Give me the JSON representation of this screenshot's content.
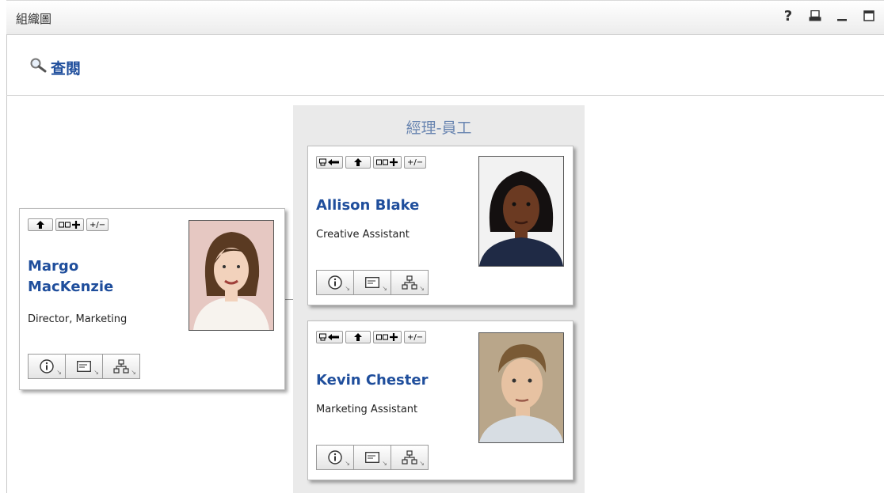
{
  "portlet": {
    "title": "組織圖",
    "controls": {
      "help": "?",
      "print": "print-icon",
      "minimize": "minimize-icon",
      "maximize": "maximize-icon"
    }
  },
  "lookup": {
    "label": "查閱"
  },
  "panel": {
    "title": "經理-員工"
  },
  "manager": {
    "name_line1": "Margo",
    "name_line2": "MacKenzie",
    "title": "Director, Marketing"
  },
  "employees": [
    {
      "name": "Allison Blake",
      "title": "Creative Assistant"
    },
    {
      "name": "Kevin Chester",
      "title": "Marketing Assistant"
    }
  ],
  "toolbar_buttons": {
    "set_manager": "set-manager-icon",
    "up": "up-arrow-icon",
    "add_reports": "add-reports-icon",
    "expand_collapse": "+/−"
  },
  "colors": {
    "link": "#1f4e9c",
    "panel_title": "#6a86b1",
    "panel_bg": "#eaeaea"
  }
}
